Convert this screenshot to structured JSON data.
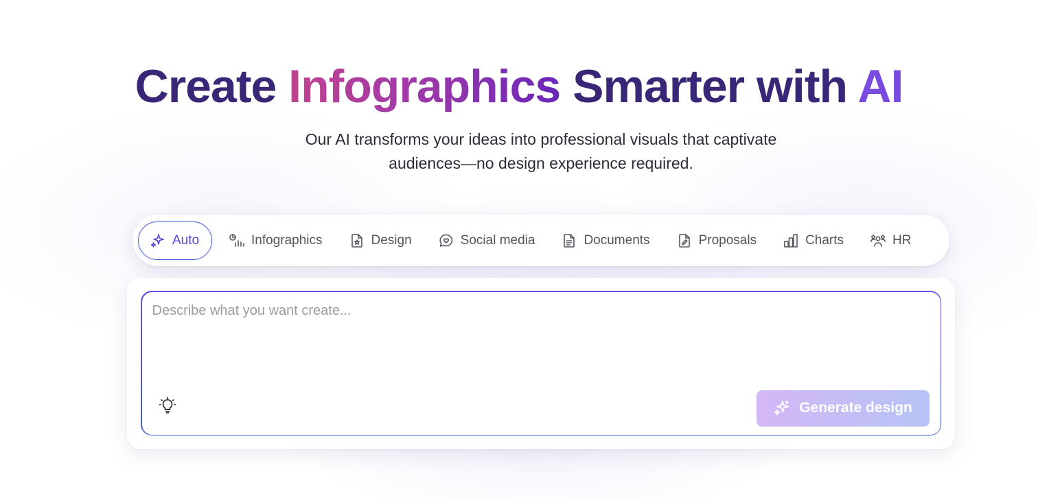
{
  "hero": {
    "title_part1": "Create ",
    "title_highlight": "Infographics",
    "title_part2": " Smarter with ",
    "title_ai": "AI",
    "subtitle_line1": "Our AI transforms your ideas into professional visuals that captivate",
    "subtitle_line2": "audiences—no design experience required."
  },
  "tabs": [
    {
      "label": "Auto",
      "icon": "sparkle-icon",
      "active": true
    },
    {
      "label": "Infographics",
      "icon": "infographic-icon"
    },
    {
      "label": "Design",
      "icon": "design-file-icon"
    },
    {
      "label": "Social media",
      "icon": "chat-heart-icon"
    },
    {
      "label": "Documents",
      "icon": "document-icon"
    },
    {
      "label": "Proposals",
      "icon": "proposal-edit-icon"
    },
    {
      "label": "Charts",
      "icon": "bar-chart-icon"
    },
    {
      "label": "HR",
      "icon": "people-icon"
    }
  ],
  "prompt": {
    "placeholder": "Describe what you want create...",
    "value": "",
    "ideas_icon": "lightbulb-icon"
  },
  "generate_button": {
    "label": "Generate design",
    "icon": "sparkle-icon"
  },
  "colors": {
    "title": "#3a2676",
    "accent": "#7a4be0",
    "active_tab": "#5b45d6",
    "button_gradient_start": "#d4b7f7",
    "button_gradient_end": "#b5c3f5"
  }
}
